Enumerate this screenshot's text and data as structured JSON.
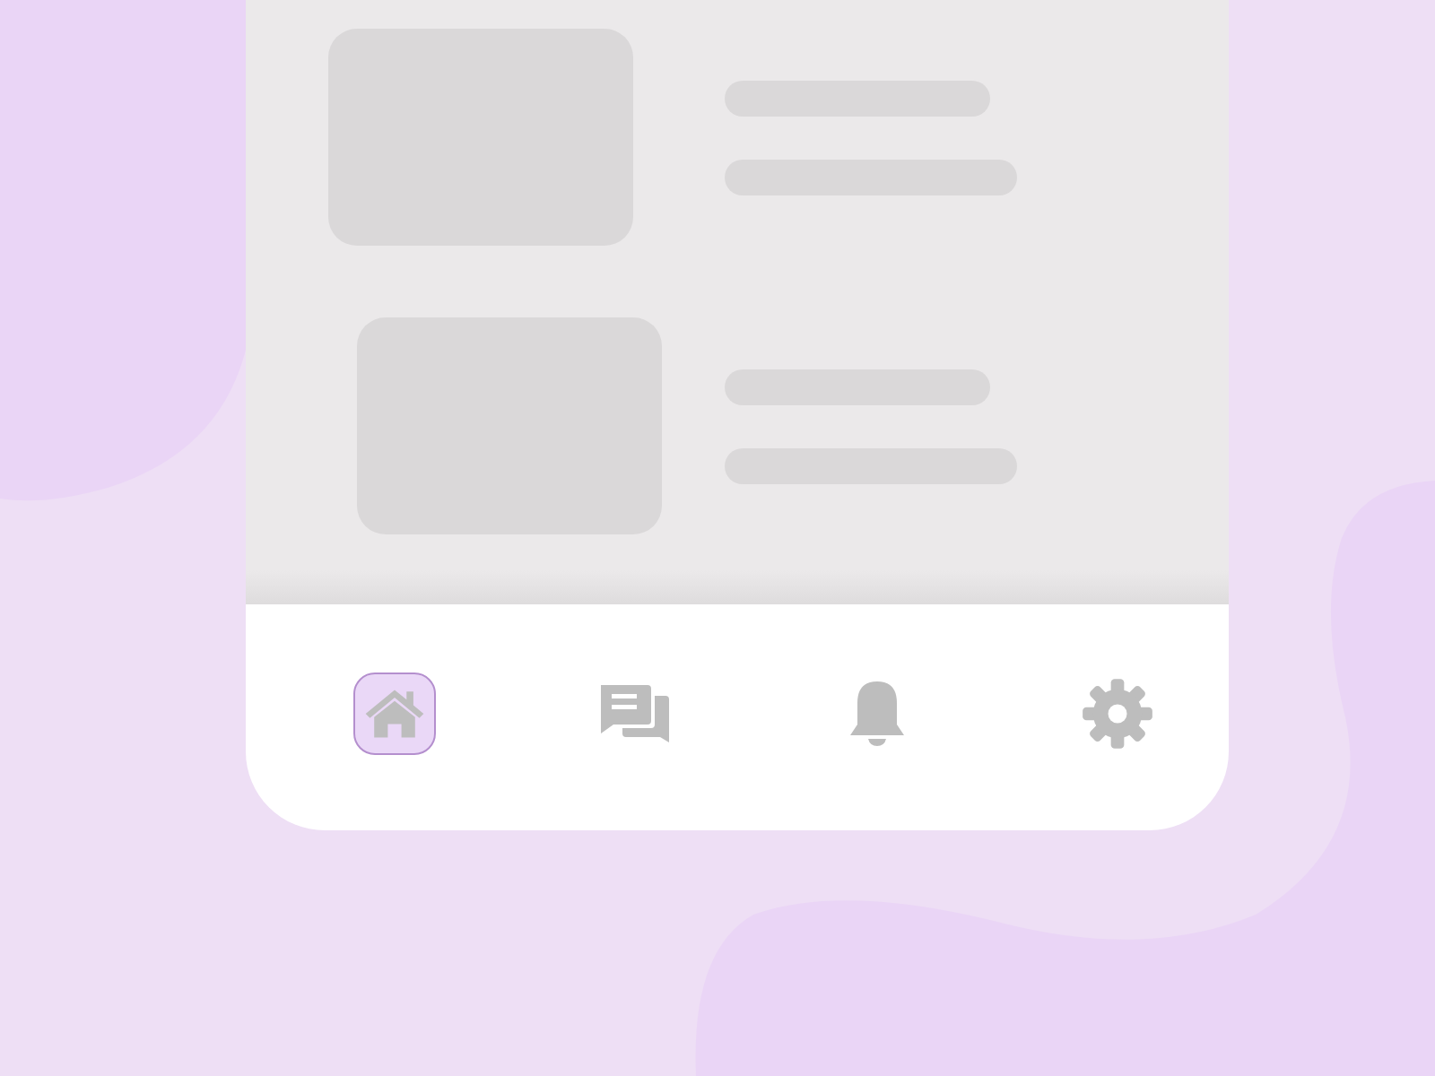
{
  "feed": {
    "items": [
      {
        "kind": "skeleton"
      },
      {
        "kind": "skeleton"
      }
    ]
  },
  "bottom_nav": {
    "items": [
      {
        "kind": "home",
        "selected": true
      },
      {
        "kind": "chat",
        "selected": false
      },
      {
        "kind": "bell",
        "selected": false
      },
      {
        "kind": "settings",
        "selected": false
      }
    ]
  }
}
